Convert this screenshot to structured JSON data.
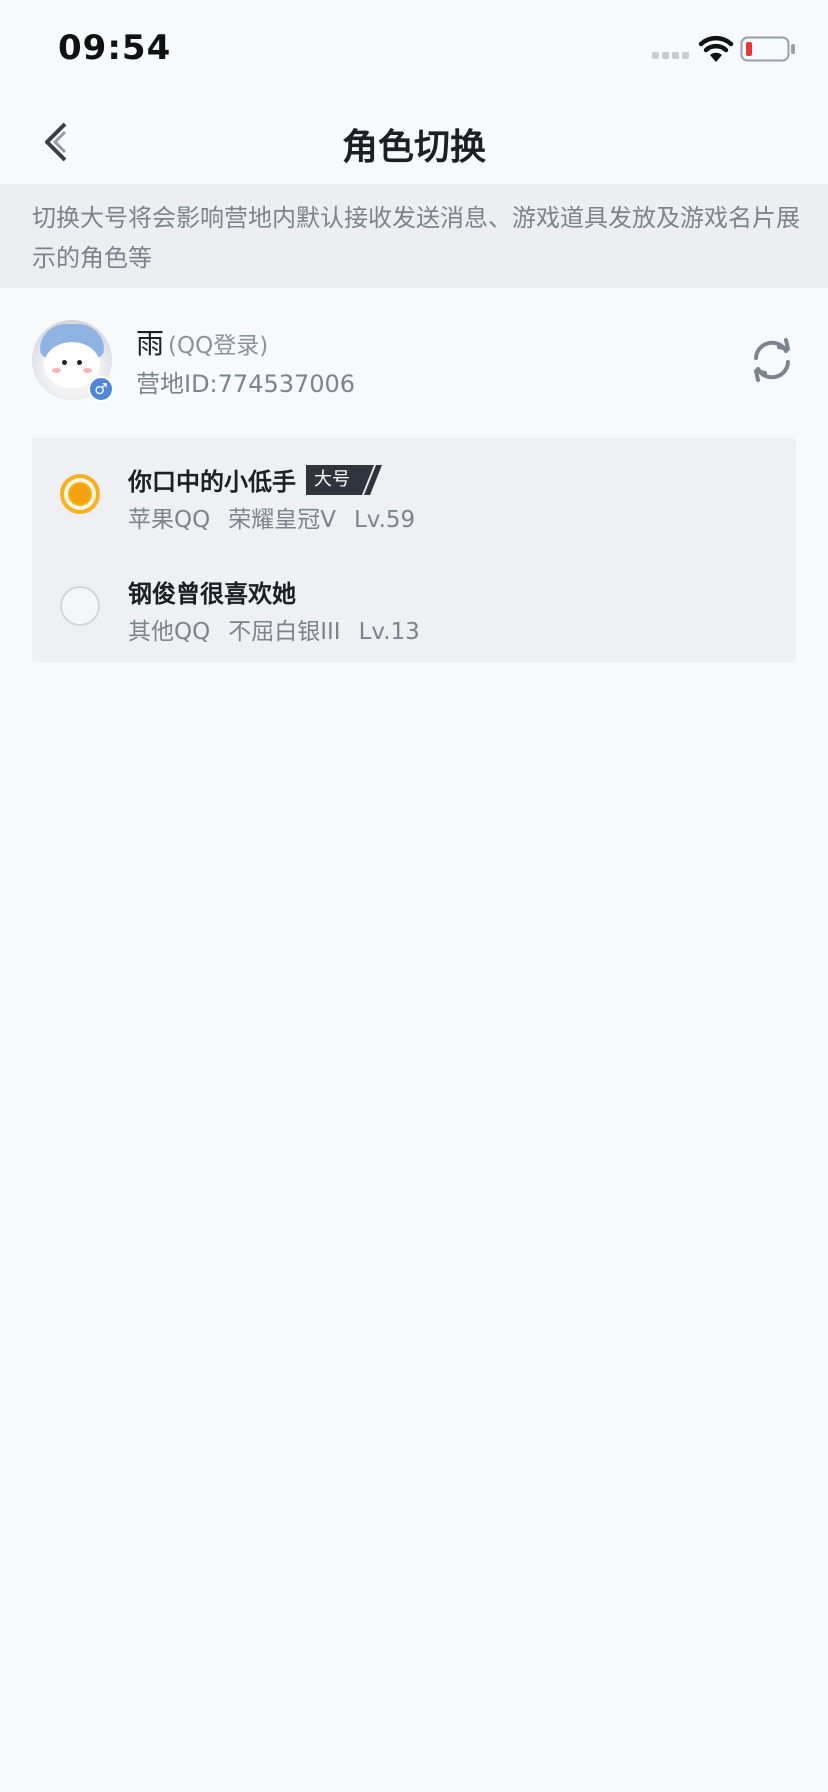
{
  "status_bar": {
    "time": "09:54"
  },
  "nav": {
    "title": "角色切换"
  },
  "notice": {
    "text": "切换大号将会影响营地内默认接收发送消息、游戏道具发放及游戏名片展示的角色等"
  },
  "account": {
    "name": "雨",
    "login_type": "(QQ登录)",
    "id_text": "营地ID:774537006",
    "gender_symbol": "♂"
  },
  "roles": [
    {
      "name": "你口中的小低手",
      "badge": "大号",
      "platform": "苹果QQ",
      "rank": "荣耀皇冠V",
      "level": "Lv.59",
      "selected": true
    },
    {
      "name": "钢俊曾很喜欢她",
      "badge": "",
      "platform": "其他QQ",
      "rank": "不屈白银III",
      "level": "Lv.13",
      "selected": false
    }
  ],
  "colors": {
    "background": "#f7f9fd",
    "notice_bg": "#eceef2",
    "accent_radio": "#f6b21e",
    "badge_bg": "#30353d",
    "gender_badge": "#4f86d6"
  },
  "icons": {
    "back": "chevron-left-icon",
    "refresh": "refresh-icon",
    "wifi": "wifi-icon",
    "battery": "battery-icon",
    "signal": "signal-icon"
  }
}
